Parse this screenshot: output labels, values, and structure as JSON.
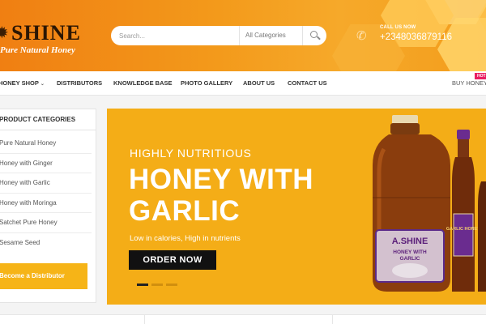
{
  "brand": {
    "name": "SHINE",
    "tagline": "Pure Natural Honey"
  },
  "search": {
    "placeholder": "Search...",
    "category_selected": "All Categories"
  },
  "contact": {
    "label": "CALL US NOW",
    "phone": "+2348036879116"
  },
  "nav": {
    "items": [
      {
        "label": "HONEY SHOP"
      },
      {
        "label": "DISTRIBUTORS"
      },
      {
        "label": "KNOWLEDGE BASE"
      },
      {
        "label": "PHOTO GALLERY"
      },
      {
        "label": "ABOUT US"
      },
      {
        "label": "CONTACT US"
      }
    ],
    "buy_label": "BUY HONEY",
    "hot_badge": "HOT"
  },
  "sidebar": {
    "title": "PRODUCT CATEGORIES",
    "items": [
      "Pure Natural Honey",
      "Honey with Ginger",
      "Honey with Garlic",
      "Honey with Moringa",
      "Satchet Pure Honey",
      "Sesame Seed"
    ],
    "distributor_button": "Become a Distributor"
  },
  "banner": {
    "subtitle": "HIGHLY NUTRITIOUS",
    "title_line1": "HONEY WITH",
    "title_line2": "GARLIC",
    "description": "Low in calories, High in nutrients",
    "cta": "ORDER NOW",
    "slides": 3,
    "active_slide": 1,
    "product_label": {
      "brand": "A.SHINE",
      "line1": "HONEY WITH",
      "line2": "GARLIC"
    },
    "bottle_label": "GARLIC HONEY"
  },
  "colors": {
    "header_orange": "#f39a1b",
    "banner_yellow": "#f4ad17",
    "button_yellow": "#f6b417",
    "hot_pink": "#e91e63"
  }
}
